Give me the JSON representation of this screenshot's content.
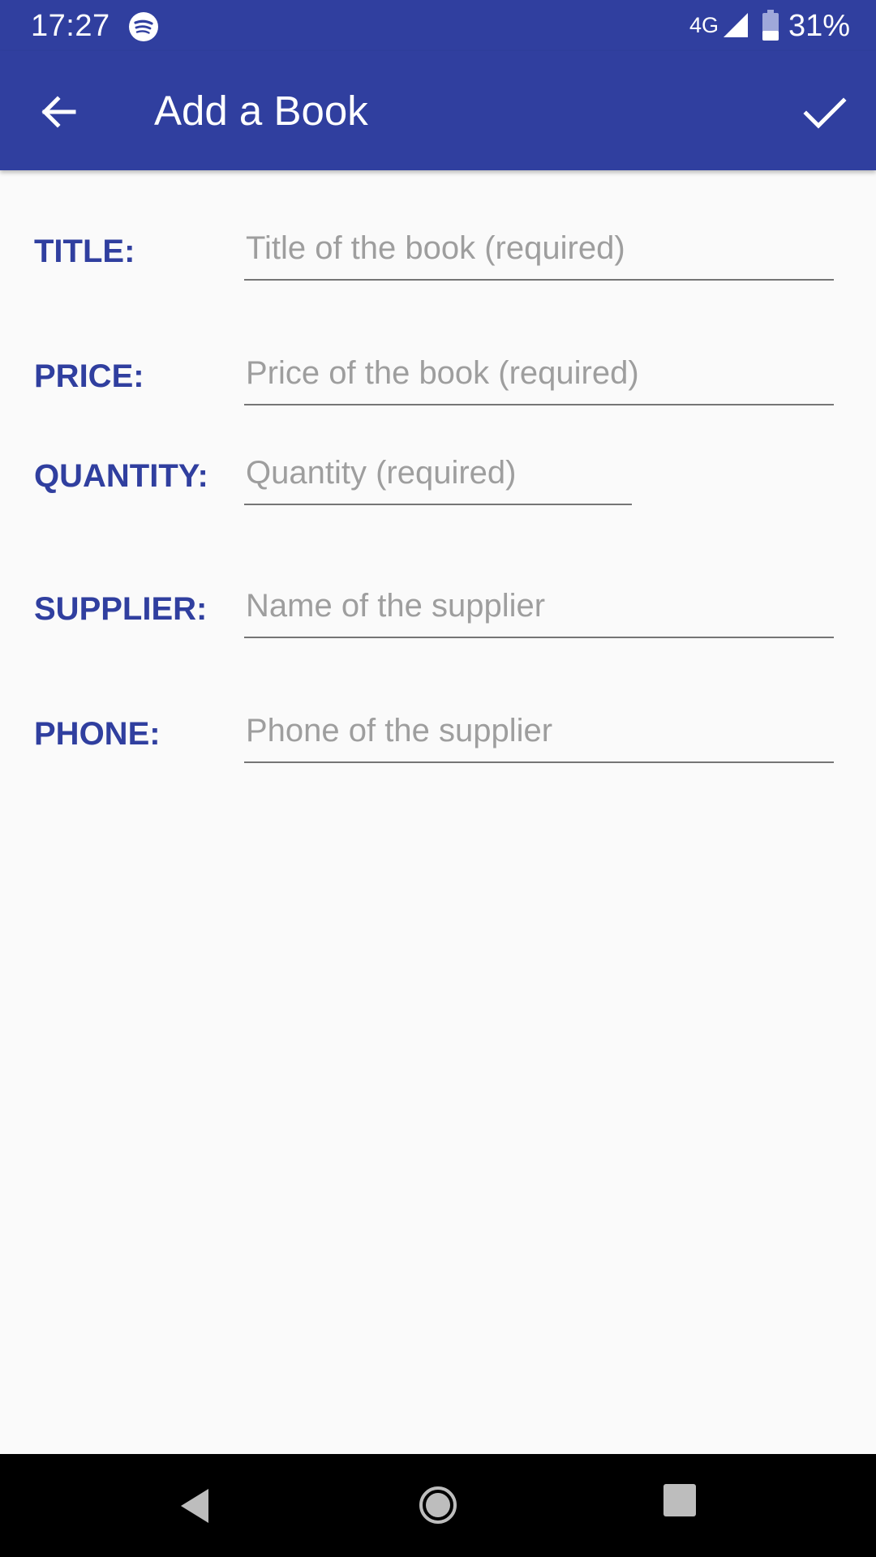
{
  "status_bar": {
    "time": "17:27",
    "network": "4G",
    "battery": "31%",
    "icons": [
      "spotify-icon",
      "signal-icon",
      "battery-icon"
    ]
  },
  "app_bar": {
    "title": "Add a Book",
    "back_icon": "arrow-left-icon",
    "save_icon": "checkmark-icon",
    "color": "#303f9f"
  },
  "form": {
    "fields": [
      {
        "label": "TITLE:",
        "placeholder": "Title of the book (required)",
        "value": ""
      },
      {
        "label": "PRICE:",
        "placeholder": "Price of the book (required)",
        "value": ""
      },
      {
        "label": "QUANTITY:",
        "placeholder": "Quantity (required)",
        "value": ""
      },
      {
        "label": "SUPPLIER:",
        "placeholder": "Name of the supplier",
        "value": ""
      },
      {
        "label": "PHONE:",
        "placeholder": "Phone of the supplier",
        "value": ""
      }
    ],
    "label_color": "#303f9f"
  },
  "nav_bar": {
    "icons": [
      "back-triangle-icon",
      "home-circle-icon",
      "recents-square-icon"
    ]
  }
}
